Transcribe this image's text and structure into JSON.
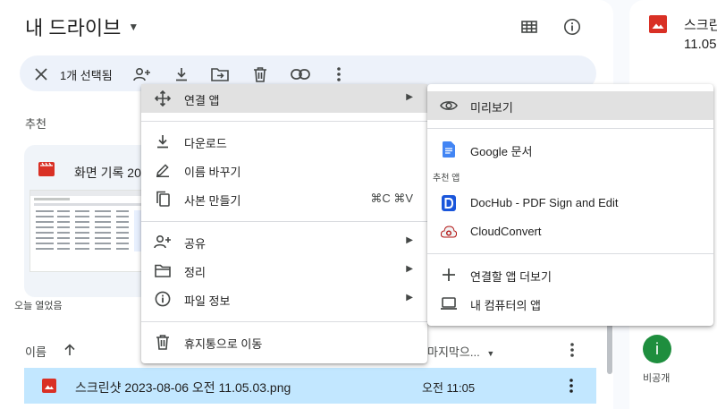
{
  "header": {
    "title": "내 드라이브"
  },
  "selection_bar": {
    "count_label": "1개 선택됨"
  },
  "suggested": {
    "section_label": "추천",
    "card_title": "화면 기록 2023",
    "card_footer": "오늘 열었음"
  },
  "list": {
    "col_name": "이름",
    "col_modified": "마지막으...",
    "rows": [
      {
        "name": "스크린샷 2023-08-06 오전 11.05.03.png",
        "modified": "오전 11:05"
      }
    ]
  },
  "context_menu": {
    "items": [
      {
        "label": "연결 앱",
        "icon": "move-arrows-icon",
        "submenu": true
      },
      {
        "label": "다운로드",
        "icon": "download-icon"
      },
      {
        "label": "이름 바꾸기",
        "icon": "pencil-icon"
      },
      {
        "label": "사본 만들기",
        "icon": "copy-icon",
        "shortcut": "⌘C ⌘V"
      },
      {
        "label": "공유",
        "icon": "person-add-icon",
        "submenu": true
      },
      {
        "label": "정리",
        "icon": "folder-icon",
        "submenu": true
      },
      {
        "label": "파일 정보",
        "icon": "info-icon",
        "submenu": true
      },
      {
        "label": "휴지통으로 이동",
        "icon": "trash-icon"
      }
    ]
  },
  "submenu": {
    "preview": "미리보기",
    "google_docs": "Google 문서",
    "recommended_header": "추천 앱",
    "dochub": "DocHub - PDF Sign and Edit",
    "cloudconvert": "CloudConvert",
    "more_apps": "연결할 앱 더보기",
    "computer_apps": "내 컴퓨터의 앱"
  },
  "right_panel": {
    "title_line1": "스크린",
    "title_line2": "11.05",
    "avatar_letter": "i",
    "privacy": "비공개"
  },
  "colors": {
    "selection_bg": "#c2e7ff",
    "bar_bg": "#edf2fa",
    "image_icon_red": "#d93025",
    "avatar_green": "#1e8e3e",
    "docs_blue": "#4285f4"
  }
}
